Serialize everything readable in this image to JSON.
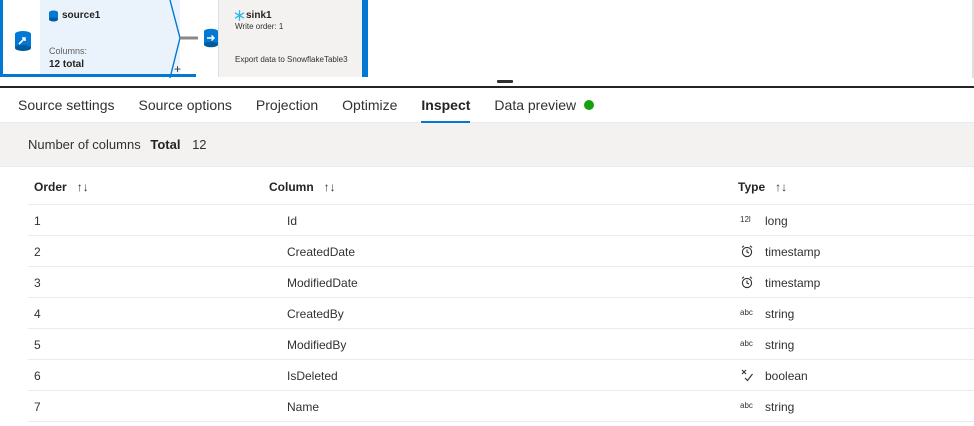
{
  "canvas": {
    "source": {
      "title": "source1",
      "columns_label": "Columns:",
      "columns_value": "12 total"
    },
    "sink": {
      "title": "sink1",
      "write_order": "Write order: 1",
      "export_text": "Export data to SnowflakeTable3"
    }
  },
  "tabs": [
    {
      "label": "Source settings",
      "active": false
    },
    {
      "label": "Source options",
      "active": false
    },
    {
      "label": "Projection",
      "active": false
    },
    {
      "label": "Optimize",
      "active": false
    },
    {
      "label": "Inspect",
      "active": true
    },
    {
      "label": "Data preview",
      "active": false
    }
  ],
  "summary": {
    "label": "Number of columns",
    "total_label": "Total",
    "total_value": "12"
  },
  "table": {
    "headers": {
      "order": "Order",
      "column": "Column",
      "type": "Type",
      "sort_icon": "↑↓"
    },
    "rows": [
      {
        "order": "1",
        "column": "Id",
        "type": "long",
        "type_icon": "long-type-icon",
        "icon_text": "12l"
      },
      {
        "order": "2",
        "column": "CreatedDate",
        "type": "timestamp",
        "type_icon": "timestamp-type-icon",
        "icon_text": ""
      },
      {
        "order": "3",
        "column": "ModifiedDate",
        "type": "timestamp",
        "type_icon": "timestamp-type-icon",
        "icon_text": ""
      },
      {
        "order": "4",
        "column": "CreatedBy",
        "type": "string",
        "type_icon": "string-type-icon",
        "icon_text": "abc"
      },
      {
        "order": "5",
        "column": "ModifiedBy",
        "type": "string",
        "type_icon": "string-type-icon",
        "icon_text": "abc"
      },
      {
        "order": "6",
        "column": "IsDeleted",
        "type": "boolean",
        "type_icon": "boolean-type-icon",
        "icon_text": ""
      },
      {
        "order": "7",
        "column": "Name",
        "type": "string",
        "type_icon": "string-type-icon",
        "icon_text": "abc"
      }
    ]
  },
  "colors": {
    "accent": "#0078d4",
    "status_ok": "#13a10e",
    "summary_bg": "#f3f2f1"
  }
}
